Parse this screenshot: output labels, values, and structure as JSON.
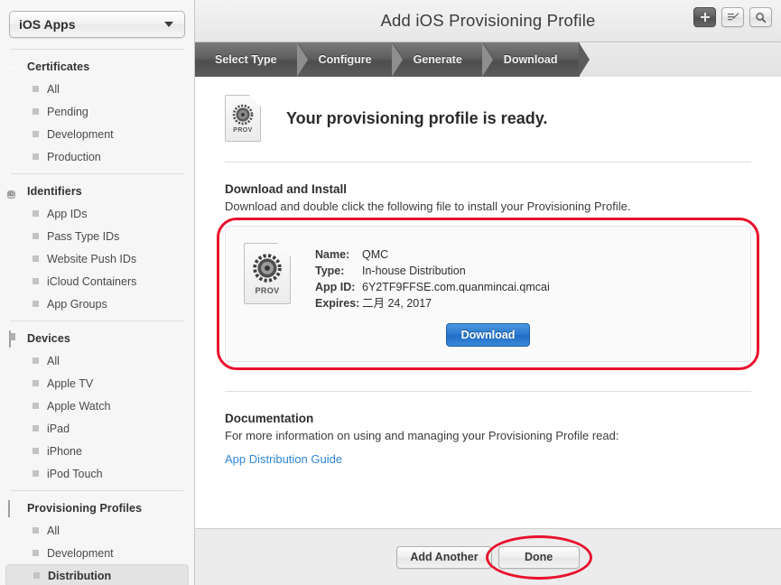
{
  "sidebar": {
    "account_selector": {
      "label": "iOS Apps",
      "icon": "chevron-down-icon"
    },
    "sections": [
      {
        "id": "certificates",
        "icon": "certificate-seal-icon",
        "label": "Certificates",
        "items": [
          {
            "label": "All",
            "selected": false
          },
          {
            "label": "Pending",
            "selected": false
          },
          {
            "label": "Development",
            "selected": false
          },
          {
            "label": "Production",
            "selected": false
          }
        ]
      },
      {
        "id": "identifiers",
        "icon": "id-badge-icon",
        "label": "Identifiers",
        "items": [
          {
            "label": "App IDs",
            "selected": false
          },
          {
            "label": "Pass Type IDs",
            "selected": false
          },
          {
            "label": "Website Push IDs",
            "selected": false
          },
          {
            "label": "iCloud Containers",
            "selected": false
          },
          {
            "label": "App Groups",
            "selected": false
          }
        ]
      },
      {
        "id": "devices",
        "icon": "device-phone-icon",
        "label": "Devices",
        "items": [
          {
            "label": "All",
            "selected": false
          },
          {
            "label": "Apple TV",
            "selected": false
          },
          {
            "label": "Apple Watch",
            "selected": false
          },
          {
            "label": "iPad",
            "selected": false
          },
          {
            "label": "iPhone",
            "selected": false
          },
          {
            "label": "iPod Touch",
            "selected": false
          }
        ]
      },
      {
        "id": "provisioning-profiles",
        "icon": "document-icon",
        "label": "Provisioning Profiles",
        "items": [
          {
            "label": "All",
            "selected": false
          },
          {
            "label": "Development",
            "selected": false
          },
          {
            "label": "Distribution",
            "selected": true
          }
        ]
      }
    ]
  },
  "header": {
    "title": "Add iOS Provisioning Profile",
    "actions": [
      {
        "id": "add",
        "icon": "plus-icon",
        "active": true
      },
      {
        "id": "edit",
        "icon": "edit-pencil-icon",
        "active": false
      },
      {
        "id": "search",
        "icon": "search-icon",
        "active": false
      }
    ]
  },
  "wizard": {
    "steps": [
      {
        "label": "Select Type",
        "state": "complete"
      },
      {
        "label": "Configure",
        "state": "complete"
      },
      {
        "label": "Generate",
        "state": "complete"
      },
      {
        "label": "Download",
        "state": "current"
      }
    ]
  },
  "main": {
    "ready_heading": "Your provisioning profile is ready.",
    "ready_icon_label": "PROV",
    "download_section": {
      "title": "Download and Install",
      "description": "Download and double click the following file to install your Provisioning Profile."
    },
    "profile_card": {
      "icon_label": "PROV",
      "fields": [
        {
          "key": "Name:",
          "value": "QMC"
        },
        {
          "key": "Type:",
          "value": "In-house Distribution"
        },
        {
          "key": "App ID:",
          "value": "6Y2TF9FFSE.com.quanmincai.qmcai"
        },
        {
          "key": "Expires:",
          "value": "二月 24, 2017"
        }
      ],
      "download_button": "Download",
      "highlight_color": "#e8112d"
    },
    "documentation_section": {
      "title": "Documentation",
      "description": "For more information on using and managing your Provisioning Profile read:",
      "link_text": "App Distribution Guide",
      "link_color": "#2f87d8"
    }
  },
  "footer": {
    "add_another_label": "Add Another",
    "done_label": "Done",
    "done_highlight_color": "#e8112d"
  }
}
